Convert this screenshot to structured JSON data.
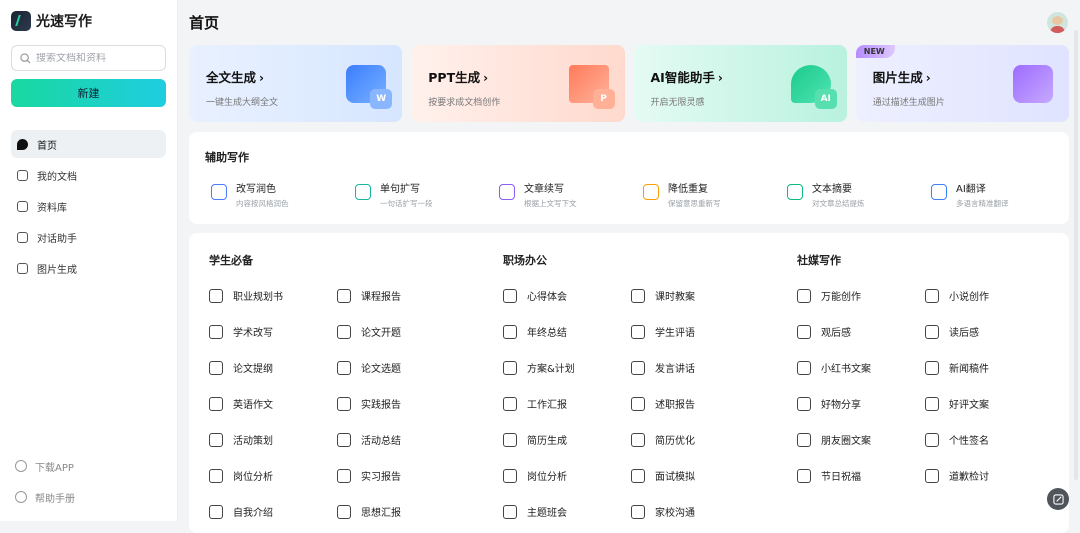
{
  "app": {
    "name": "光速写作"
  },
  "search": {
    "placeholder": "搜索文档和资料"
  },
  "sidebar": {
    "new_label": "新建",
    "items": [
      {
        "label": "首页",
        "icon": "home-icon",
        "active": true
      },
      {
        "label": "我的文档",
        "icon": "document-icon"
      },
      {
        "label": "资料库",
        "icon": "library-icon"
      },
      {
        "label": "对话助手",
        "icon": "chat-icon"
      },
      {
        "label": "图片生成",
        "icon": "image-icon"
      }
    ],
    "bottom": [
      {
        "label": "下载APP",
        "icon": "download-icon"
      },
      {
        "label": "帮助手册",
        "icon": "help-icon"
      }
    ]
  },
  "header": {
    "title": "首页"
  },
  "features": [
    {
      "title": "全文生成",
      "desc": "一键生成大纲全文",
      "icon": "word-doc-icon",
      "badge": "W"
    },
    {
      "title": "PPT生成",
      "desc": "按要求成文档创作",
      "icon": "presentation-icon",
      "badge": "P"
    },
    {
      "title": "AI智能助手",
      "desc": "开启无限灵感",
      "icon": "ai-chat-icon",
      "badge": "AI"
    },
    {
      "title": "图片生成",
      "desc": "通过描述生成图片",
      "icon": "image-gen-icon",
      "badge": "",
      "tag": "NEW"
    }
  ],
  "assist": {
    "title": "辅助写作",
    "items": [
      {
        "title": "改写润色",
        "desc": "内容按风格润色",
        "color": "#4b7bff"
      },
      {
        "title": "单句扩写",
        "desc": "一句话扩写一段",
        "color": "#19b4a0"
      },
      {
        "title": "文章续写",
        "desc": "根据上文写下文",
        "color": "#8b5cf6"
      },
      {
        "title": "降低重复",
        "desc": "保留意思重新写",
        "color": "#f59e0b"
      },
      {
        "title": "文本摘要",
        "desc": "对文章总结提炼",
        "color": "#10b981"
      },
      {
        "title": "AI翻译",
        "desc": "多语言精准翻译",
        "color": "#3b82f6"
      }
    ]
  },
  "sections": [
    {
      "title": "学生必备",
      "items": [
        "职业规划书",
        "课程报告",
        "学术改写",
        "论文开题",
        "论文提纲",
        "论文选题",
        "英语作文",
        "实践报告",
        "活动策划",
        "活动总结",
        "岗位分析",
        "实习报告",
        "自我介绍",
        "思想汇报"
      ]
    },
    {
      "title": "职场办公",
      "items": [
        "心得体会",
        "课时教案",
        "年终总结",
        "学生评语",
        "方案&计划",
        "发言讲话",
        "工作汇报",
        "述职报告",
        "简历生成",
        "简历优化",
        "岗位分析",
        "面试模拟",
        "主题班会",
        "家校沟通"
      ]
    },
    {
      "title": "社媒写作",
      "items": [
        "万能创作",
        "小说创作",
        "观后感",
        "读后感",
        "小红书文案",
        "新闻稿件",
        "好物分享",
        "好评文案",
        "朋友圈文案",
        "个性签名",
        "节日祝福",
        "道歉检讨"
      ]
    }
  ]
}
